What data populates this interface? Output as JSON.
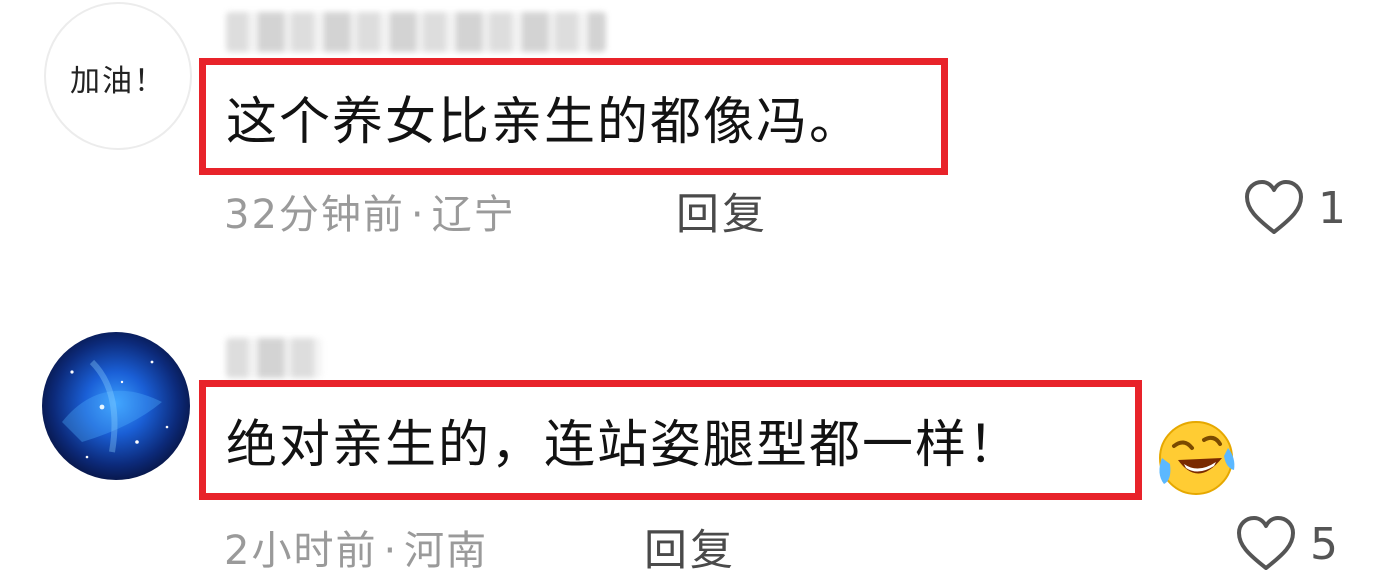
{
  "comments": [
    {
      "avatar_text": "加油！",
      "text": "这个养女比亲生的都像冯。",
      "time": "32分钟前",
      "location": "辽宁",
      "reply_label": "回复",
      "like_count": "1",
      "avatar_icon": "handwritten-text-avatar"
    },
    {
      "avatar_text": "",
      "text": "绝对亲生的，连站姿腿型都一样！",
      "time": "2小时前",
      "location": "河南",
      "reply_label": "回复",
      "like_count": "5",
      "avatar_icon": "galaxy-avatar",
      "emoji_icon": "laughing-crying-emoji"
    }
  ],
  "meta_separator": "·",
  "colors": {
    "highlight_border": "#e8232a",
    "meta_text": "#9a9a9a",
    "reply_text": "#4a4a4a",
    "heart_outline": "#555555"
  }
}
